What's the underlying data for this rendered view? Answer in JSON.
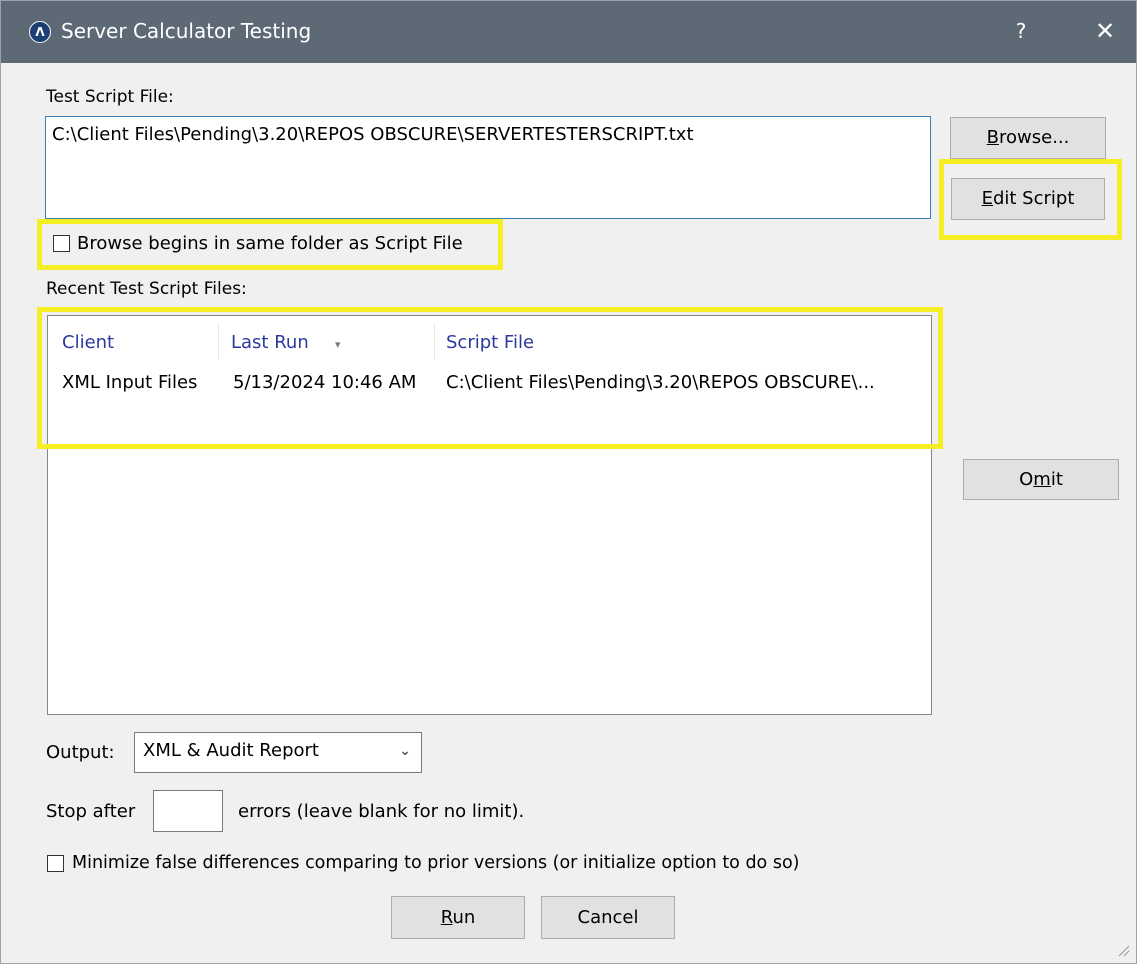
{
  "window": {
    "title": "Server Calculator Testing",
    "app_icon_glyph": "Λ",
    "help_label": "?",
    "close_label": "✕"
  },
  "script_file": {
    "label": "Test Script File:",
    "value": "C:\\Client Files\\Pending\\3.20\\REPOS OBSCURE\\SERVERTESTERSCRIPT.txt"
  },
  "buttons": {
    "browse_mnemonic": "B",
    "browse_rest": "rowse...",
    "edit_mnemonic": "E",
    "edit_rest": "dit Script",
    "omit_pre": "O",
    "omit_mnemonic": "m",
    "omit_rest": "it",
    "run_mnemonic": "R",
    "run_rest": "un",
    "cancel": "Cancel"
  },
  "browse_same_folder": {
    "label": "Browse begins in same folder as Script File",
    "checked": false
  },
  "recent": {
    "label": "Recent Test Script Files:",
    "columns": [
      "Client",
      "Last Run",
      "Script File"
    ],
    "sort_icon": "▾",
    "rows": [
      {
        "client": "XML Input Files",
        "last_run": "5/13/2024 10:46 AM",
        "script_file": "C:\\Client Files\\Pending\\3.20\\REPOS OBSCURE\\..."
      }
    ]
  },
  "output": {
    "label": "Output:",
    "selected": "XML & Audit Report",
    "chevron": "⌄"
  },
  "stop_after": {
    "label": "Stop after",
    "value": "",
    "suffix": "errors (leave blank for no limit)."
  },
  "minimize": {
    "label": "Minimize false differences comparing to prior versions (or initialize option to do so)",
    "checked": false
  },
  "colors": {
    "titlebar": "#5d6a75",
    "highlight": "#f6ee24",
    "column_header": "#2b3a9e"
  }
}
